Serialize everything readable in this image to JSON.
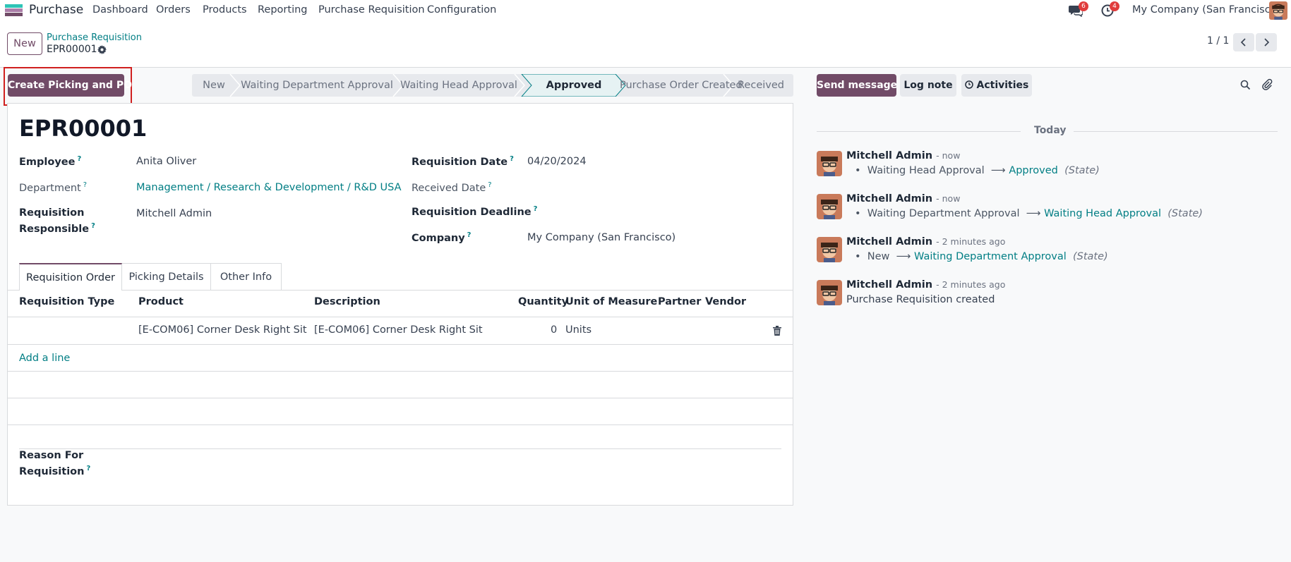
{
  "navbar": {
    "app_name": "Purchase",
    "menu": [
      "Dashboard",
      "Orders",
      "Products",
      "Reporting",
      "Purchase Requisition",
      "Configuration"
    ],
    "messages_count": "6",
    "activities_count": "4",
    "company": "My Company (San Francisco)"
  },
  "control_panel": {
    "new_button": "New",
    "breadcrumb_parent": "Purchase Requisition",
    "record_name": "EPR00001",
    "pager": "1 / 1"
  },
  "actions": {
    "create_picking_po": "Create Picking and PO"
  },
  "statusbar": {
    "stages": [
      "New",
      "Waiting Department Approval",
      "Waiting Head Approval",
      "Approved",
      "Purchase Order Created",
      "Received"
    ],
    "current": "Approved"
  },
  "form": {
    "title": "EPR00001",
    "employee_label": "Employee",
    "employee_value": "Anita Oliver",
    "department_label": "Department",
    "department_value": "Management / Research & Development / R&D USA",
    "responsible_label_1": "Requisition",
    "responsible_label_2": "Responsible",
    "responsible_value": "Mitchell Admin",
    "req_date_label": "Requisition Date",
    "req_date_value": "04/20/2024",
    "received_date_label": "Received Date",
    "deadline_label": "Requisition Deadline",
    "company_label": "Company",
    "company_value": "My Company (San Francisco)",
    "reason_label_1": "Reason For",
    "reason_label_2": "Requisition"
  },
  "tabs": [
    "Requisition Order",
    "Picking Details",
    "Other Info"
  ],
  "order_table": {
    "headers": [
      "Requisition Type",
      "Product",
      "Description",
      "Quantity",
      "Unit of Measure",
      "Partner",
      "Vendor"
    ],
    "rows": [
      {
        "type": "",
        "product": "[E-COM06] Corner Desk Right Sit",
        "description": "[E-COM06] Corner Desk Right Sit",
        "quantity": "0",
        "uom": "Units",
        "partner": "",
        "vendor": ""
      }
    ],
    "add_line": "Add a line"
  },
  "chatter": {
    "send_message": "Send message",
    "log_note": "Log note",
    "activities": "Activities",
    "date_separator": "Today",
    "messages": [
      {
        "author": "Mitchell Admin",
        "time": "- now",
        "old": "Waiting Head Approval",
        "new": "Approved",
        "field": "(State)"
      },
      {
        "author": "Mitchell Admin",
        "time": "- now",
        "old": "Waiting Department Approval",
        "new": "Waiting Head Approval",
        "field": "(State)"
      },
      {
        "author": "Mitchell Admin",
        "time": "- 2 minutes ago",
        "old": "New",
        "new": "Waiting Department Approval",
        "field": "(State)"
      },
      {
        "author": "Mitchell Admin",
        "time": "- 2 minutes ago",
        "body": "Purchase Requisition created"
      }
    ]
  },
  "colors": {
    "brand": "#714b67",
    "link": "#017e84",
    "badge": "#e03c3c",
    "highlight_box": "#d0201f"
  }
}
